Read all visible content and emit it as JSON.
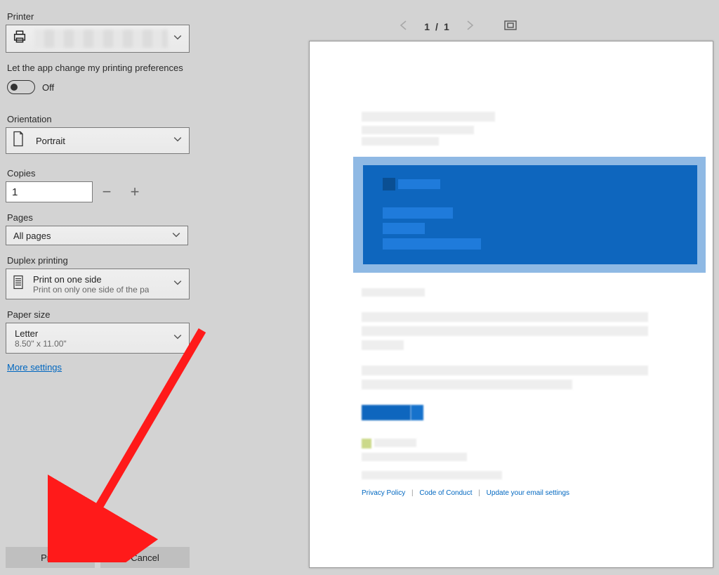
{
  "panel": {
    "printer_label": "Printer",
    "app_change_label": "Let the app change my printing preferences",
    "app_change_toggle": "Off",
    "orientation_label": "Orientation",
    "orientation_value": "Portrait",
    "copies_label": "Copies",
    "copies_value": "1",
    "pages_label": "Pages",
    "pages_value": "All pages",
    "duplex_label": "Duplex printing",
    "duplex_value": "Print on one side",
    "duplex_sub": "Print on only one side of the pa",
    "paper_label": "Paper size",
    "paper_value": "Letter",
    "paper_sub": "8.50\" x 11.00\"",
    "more_settings": "More settings",
    "print_btn": "Print",
    "cancel_btn": "Cancel"
  },
  "preview": {
    "page_current": "1",
    "page_sep": "/",
    "page_total": "1",
    "links": {
      "a": "Privacy Policy",
      "b": "Code of Conduct",
      "c": "Update your email settings"
    }
  }
}
